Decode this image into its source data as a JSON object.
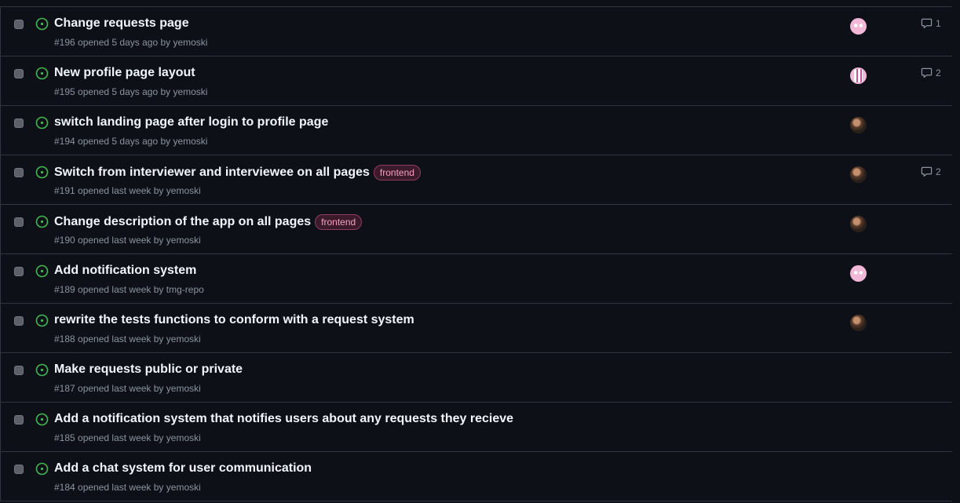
{
  "colors": {
    "open": "#3fb950",
    "label_frontend": "#f2a1c2"
  },
  "issues": [
    {
      "title": "Change requests page",
      "meta": "#196 opened 5 days ago by yemoski",
      "label": "",
      "avatar": "pink-identicon",
      "comments": "1"
    },
    {
      "title": "New profile page layout",
      "meta": "#195 opened 5 days ago by yemoski",
      "label": "",
      "avatar": "striped-identicon",
      "comments": "2"
    },
    {
      "title": "switch landing page after login to profile page",
      "meta": "#194 opened 5 days ago by yemoski",
      "label": "",
      "avatar": "photo-avatar",
      "comments": ""
    },
    {
      "title": "Switch from interviewer and interviewee on all pages",
      "meta": "#191 opened last week by yemoski",
      "label": "frontend",
      "avatar": "photo-avatar",
      "comments": "2"
    },
    {
      "title": "Change description of the app on all pages",
      "meta": "#190 opened last week by yemoski",
      "label": "frontend",
      "avatar": "photo-avatar",
      "comments": ""
    },
    {
      "title": "Add notification system",
      "meta": "#189 opened last week by tmg-repo",
      "label": "",
      "avatar": "pink-identicon",
      "comments": ""
    },
    {
      "title": "rewrite the tests functions to conform with a request system",
      "meta": "#188 opened last week by yemoski",
      "label": "",
      "avatar": "photo-avatar",
      "comments": ""
    },
    {
      "title": "Make requests public or private",
      "meta": "#187 opened last week by yemoski",
      "label": "",
      "avatar": "",
      "comments": ""
    },
    {
      "title": "Add a notification system that notifies users about any requests they recieve",
      "meta": "#185 opened last week by yemoski",
      "label": "",
      "avatar": "",
      "comments": ""
    },
    {
      "title": "Add a chat system for user communication",
      "meta": "#184 opened last week by yemoski",
      "label": "",
      "avatar": "",
      "comments": ""
    }
  ]
}
